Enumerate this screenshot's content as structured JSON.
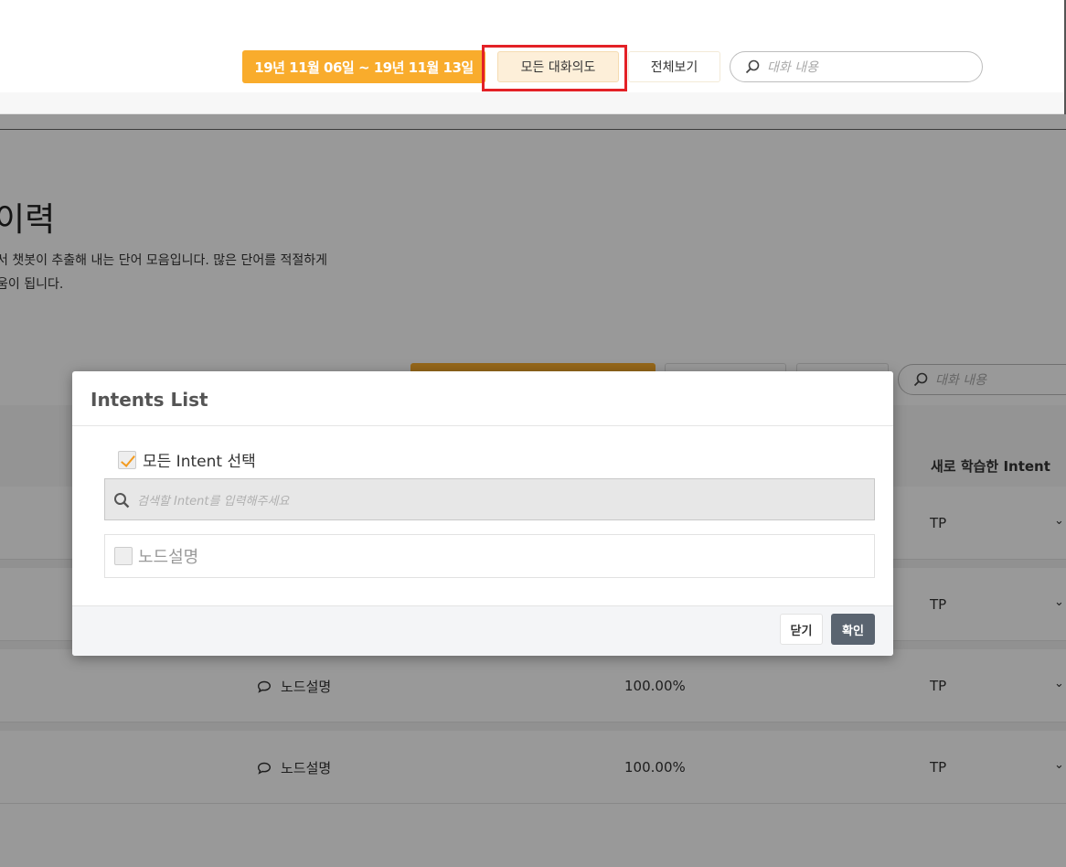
{
  "header": {
    "date_range": "19년 11월 06일 ~ 19년 11월 13일",
    "all_intent_label": "모든 대화의도",
    "view_all_label": "전체보기",
    "search_placeholder": "대화 내용"
  },
  "page": {
    "title": "이력",
    "description_line1": "서 챗봇이 추출해 내는 단어 모음입니다. 많은 단어를 적절하게",
    "description_line2": "움이 됩니다.",
    "search_placeholder": "대화 내용",
    "table_header_new_intent": "새로 학습한 Intent",
    "rows": [
      {
        "intent": "",
        "rate": "",
        "tp": "TP"
      },
      {
        "intent": "",
        "rate": "",
        "tp": "TP"
      },
      {
        "intent": "노드설명",
        "rate": "100.00%",
        "tp": "TP"
      },
      {
        "intent": "노드설명",
        "rate": "100.00%",
        "tp": "TP"
      }
    ]
  },
  "modal": {
    "title": "Intents List",
    "select_all_label": "모든 Intent 선택",
    "select_all_checked": true,
    "search_placeholder": "검색할 Intent를 입력해주세요",
    "items": [
      {
        "label": "노드설명",
        "checked": false
      }
    ],
    "close_label": "닫기",
    "confirm_label": "확인"
  },
  "colors": {
    "accent_orange": "#f9ac2c",
    "highlight_red": "#e32126",
    "confirm_button": "#5a6470"
  }
}
